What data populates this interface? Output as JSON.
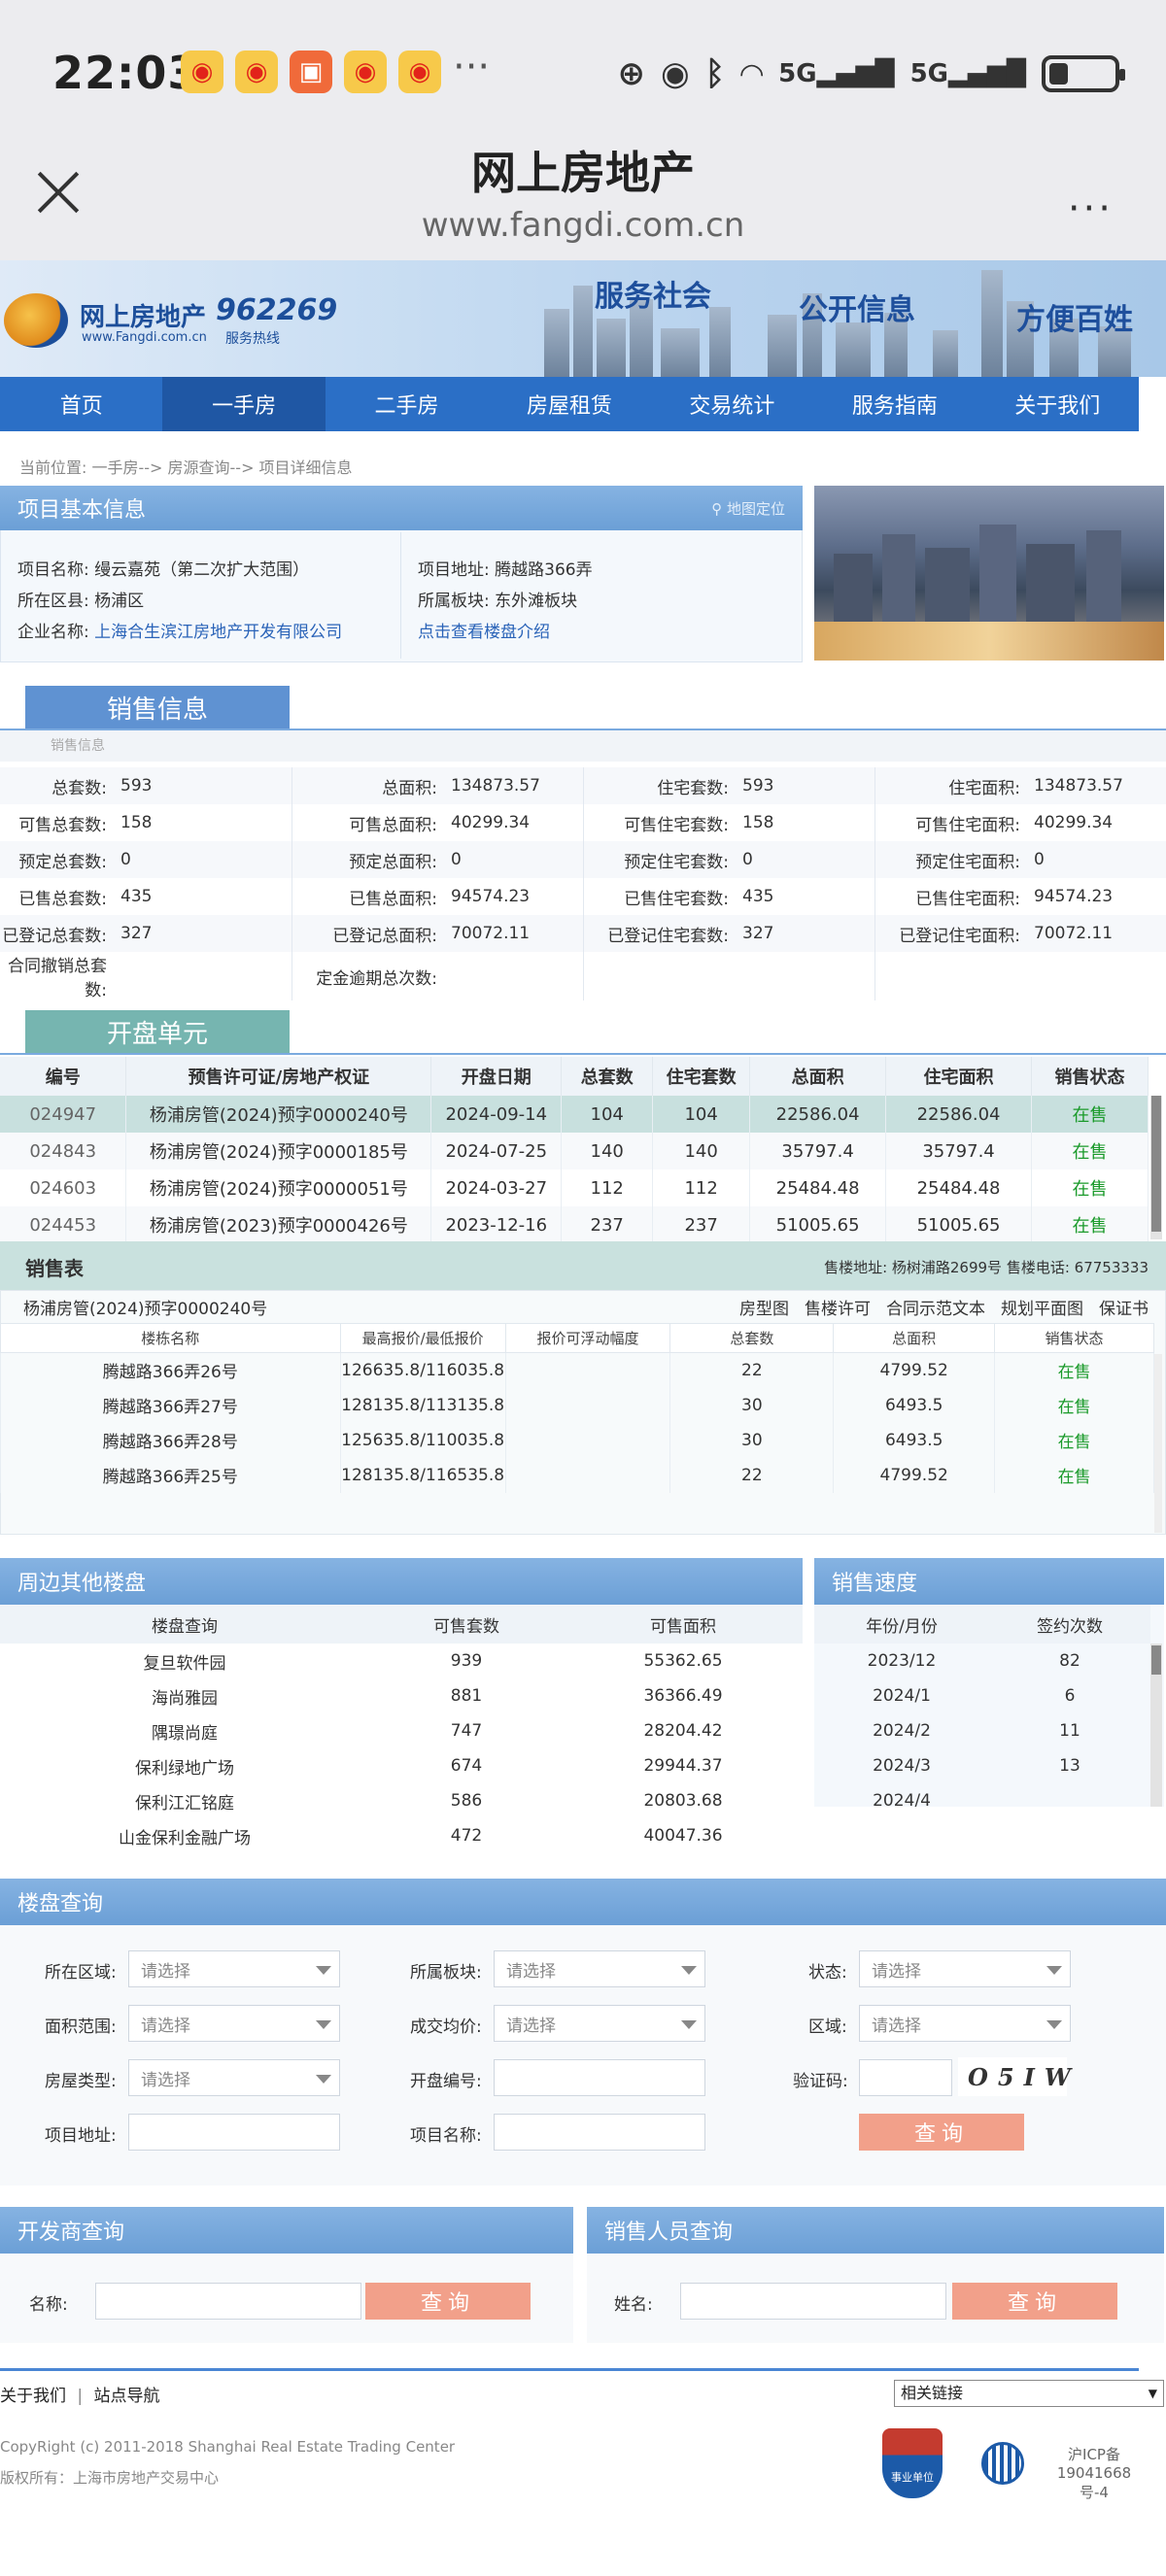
{
  "status_bar": {
    "time": "22:03",
    "dots": "···",
    "net1": "5G",
    "net2": "5G"
  },
  "browser": {
    "title": "网上房地产",
    "url": "www.fangdi.com.cn",
    "more": "···"
  },
  "banner": {
    "logo_text": "网上房地产",
    "logo_sub": "www.Fangdi.com.cn",
    "hotline": "962269",
    "hotline_sub": "服务热线",
    "slogans": [
      "服务社会",
      "公开信息",
      "方便百姓"
    ]
  },
  "menu": [
    "首页",
    "一手房",
    "二手房",
    "房屋租赁",
    "交易统计",
    "服务指南",
    "关于我们"
  ],
  "breadcrumb": "当前位置:  一手房--> 房源查询--> 项目详细信息",
  "project": {
    "header": "项目基本信息",
    "map_link": "地图定位",
    "name_label": "项目名称:",
    "name": "缦云嘉苑（第二次扩大范围）",
    "district_label": "所在区县:",
    "district": "杨浦区",
    "company_label": "企业名称:",
    "company": "上海合生滨江房地产开发有限公司",
    "address_label": "项目地址:",
    "address": "腾越路366弄",
    "block_label": "所属板块:",
    "block": "东外滩板块",
    "intro_link": "点击查看楼盘介绍"
  },
  "sales_info": {
    "tab": "销售信息",
    "sub": "销售信息",
    "rows": [
      [
        "总套数:",
        "593",
        "总面积:",
        "134873.57",
        "住宅套数:",
        "593",
        "住宅面积:",
        "134873.57"
      ],
      [
        "可售总套数:",
        "158",
        "可售总面积:",
        "40299.34",
        "可售住宅套数:",
        "158",
        "可售住宅面积:",
        "40299.34"
      ],
      [
        "预定总套数:",
        "0",
        "预定总面积:",
        "0",
        "预定住宅套数:",
        "0",
        "预定住宅面积:",
        "0"
      ],
      [
        "已售总套数:",
        "435",
        "已售总面积:",
        "94574.23",
        "已售住宅套数:",
        "435",
        "已售住宅面积:",
        "94574.23"
      ],
      [
        "已登记总套数:",
        "327",
        "已登记总面积:",
        "70072.11",
        "已登记住宅套数:",
        "327",
        "已登记住宅面积:",
        "70072.11"
      ],
      [
        "合同撤销总套数:",
        "",
        "定金逾期总次数:",
        "",
        "",
        "",
        "",
        ""
      ]
    ]
  },
  "units": {
    "tab": "开盘单元",
    "headers": [
      "编号",
      "预售许可证/房地产权证",
      "开盘日期",
      "总套数",
      "住宅套数",
      "总面积",
      "住宅面积",
      "销售状态"
    ],
    "rows": [
      [
        "024947",
        "杨浦房管(2024)预字0000240号",
        "2024-09-14",
        "104",
        "104",
        "22586.04",
        "22586.04",
        "在售"
      ],
      [
        "024843",
        "杨浦房管(2024)预字0000185号",
        "2024-07-25",
        "140",
        "140",
        "35797.4",
        "35797.4",
        "在售"
      ],
      [
        "024603",
        "杨浦房管(2024)预字0000051号",
        "2024-03-27",
        "112",
        "112",
        "25484.48",
        "25484.48",
        "在售"
      ],
      [
        "024453",
        "杨浦房管(2023)预字0000426号",
        "2023-12-16",
        "237",
        "237",
        "51005.65",
        "51005.65",
        "在售"
      ]
    ]
  },
  "sales_table": {
    "title": "销售表",
    "office": "售楼地址:  杨树浦路2699号  售楼电话:  67753333",
    "permit": "杨浦房管(2024)预字0000240号",
    "links": [
      "房型图",
      "售楼许可",
      "合同示范文本",
      "规划平面图",
      "保证书"
    ],
    "headers": [
      "楼栋名称",
      "最高报价/最低报价",
      "报价可浮动幅度",
      "总套数",
      "总面积",
      "销售状态"
    ],
    "rows": [
      [
        "腾越路366弄26号",
        "126635.8/116035.8",
        "",
        "22",
        "4799.52",
        "在售"
      ],
      [
        "腾越路366弄27号",
        "128135.8/113135.8",
        "",
        "30",
        "6493.5",
        "在售"
      ],
      [
        "腾越路366弄28号",
        "125635.8/110035.8",
        "",
        "30",
        "6493.5",
        "在售"
      ],
      [
        "腾越路366弄25号",
        "128135.8/116535.8",
        "",
        "22",
        "4799.52",
        "在售"
      ]
    ]
  },
  "nearby": {
    "header": "周边其他楼盘",
    "headers": [
      "楼盘查询",
      "可售套数",
      "可售面积"
    ],
    "rows": [
      [
        "复旦软件园",
        "939",
        "55362.65"
      ],
      [
        "海尚雅园",
        "881",
        "36366.49"
      ],
      [
        "隅璟尚庭",
        "747",
        "28204.42"
      ],
      [
        "保利绿地广场",
        "674",
        "29944.37"
      ],
      [
        "保利江汇铭庭",
        "586",
        "20803.68"
      ],
      [
        "山金保利金融广场",
        "472",
        "40047.36"
      ]
    ]
  },
  "speed": {
    "header": "销售速度",
    "headers": [
      "年份/月份",
      "签约次数"
    ],
    "rows": [
      [
        "2023/12",
        "82"
      ],
      [
        "2024/1",
        "6"
      ],
      [
        "2024/2",
        "11"
      ],
      [
        "2024/3",
        "13"
      ]
    ],
    "partial": "2024/4"
  },
  "search": {
    "header": "楼盘查询",
    "district_label": "所在区域:",
    "block_label": "所属板块:",
    "status_label": "状态:",
    "area_label": "面积范围:",
    "price_label": "成交均价:",
    "region_label": "区域:",
    "type_label": "房屋类型:",
    "code_label": "开盘编号:",
    "captcha_label": "验证码:",
    "address_label": "项目地址:",
    "pname_label": "项目名称:",
    "placeholder": "请选择",
    "captcha": "O5IW",
    "button": "查询"
  },
  "dev_search": {
    "header": "开发商查询",
    "label": "名称:",
    "button": "查询"
  },
  "agent_search": {
    "header": "销售人员查询",
    "label": "姓名:",
    "button": "查询"
  },
  "footer": {
    "about": "关于我们",
    "sitemap": "站点导航",
    "related": "相关链接",
    "copyright": "CopyRight (c) 2011-2018 Shanghai Real Estate Trading Center",
    "owner": "版权所有：上海市房地产交易中心",
    "badge": "事业单位",
    "icp1": "沪ICP备",
    "icp2": "19041668号-4"
  },
  "colors": {
    "menu": "#2b6fc6",
    "menu_active": "#1f57a4",
    "panel": "#7aaadf",
    "green": "#1a9a2a",
    "button": "#f2a08a"
  }
}
